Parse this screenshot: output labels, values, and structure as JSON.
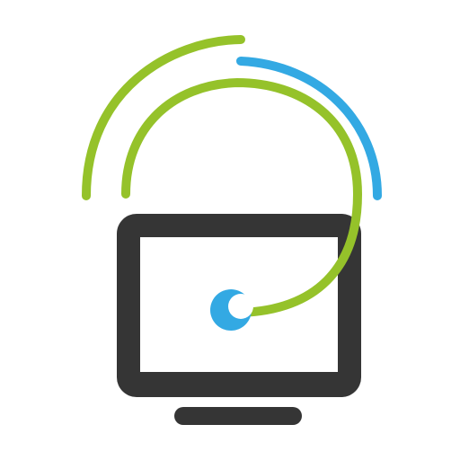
{
  "icon": {
    "name": "monitor-signal-icon",
    "colors": {
      "monitor": "#353535",
      "screen": "#ffffff",
      "green_arc": "#95c22a",
      "blue_arc": "#33a9e3",
      "dot": "#33a9e3"
    }
  }
}
